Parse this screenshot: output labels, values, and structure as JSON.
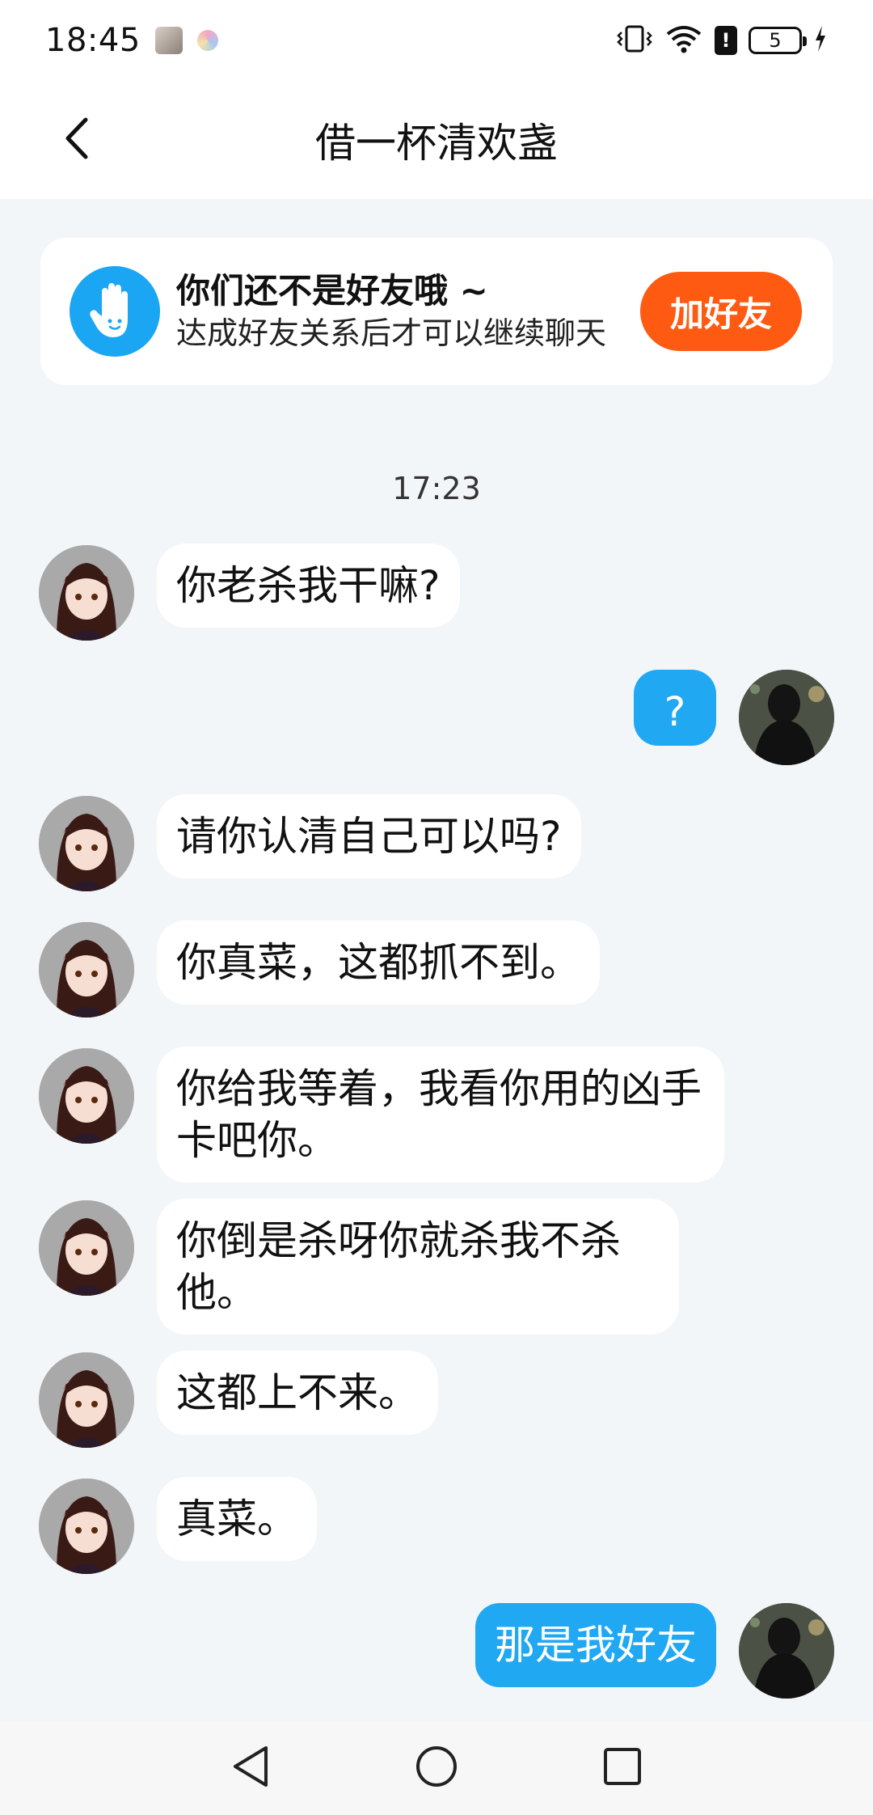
{
  "status_bar": {
    "time": "18:45",
    "battery": "5"
  },
  "header": {
    "title": "借一杯清欢盏"
  },
  "banner": {
    "title": "你们还不是好友哦 ~",
    "subtitle": "达成好友关系后才可以继续聊天",
    "button": "加好友"
  },
  "chat": {
    "timestamp": "17:23",
    "messages": [
      {
        "from": "other",
        "text": "你老杀我干嘛?"
      },
      {
        "from": "me",
        "text": "?"
      },
      {
        "from": "other",
        "text": "请你认清自己可以吗?"
      },
      {
        "from": "other",
        "text": "你真菜，这都抓不到。"
      },
      {
        "from": "other",
        "text": "你给我等着，我看你用的凶手卡吧你。"
      },
      {
        "from": "other",
        "text": "你倒是杀呀你就杀我不杀他。"
      },
      {
        "from": "other",
        "text": "这都上不来。"
      },
      {
        "from": "other",
        "text": "真菜。"
      },
      {
        "from": "me",
        "text": "那是我好友"
      }
    ]
  },
  "colors": {
    "accent": "#20a8f2",
    "add_friend": "#ff5a12",
    "background": "#f3f6f9"
  },
  "icons": [
    "back-chevron-icon",
    "hand-wave-icon",
    "vibrate-icon",
    "wifi-icon",
    "alert-icon",
    "battery-icon",
    "charging-icon",
    "nav-back-icon",
    "nav-home-icon",
    "nav-recents-icon"
  ]
}
